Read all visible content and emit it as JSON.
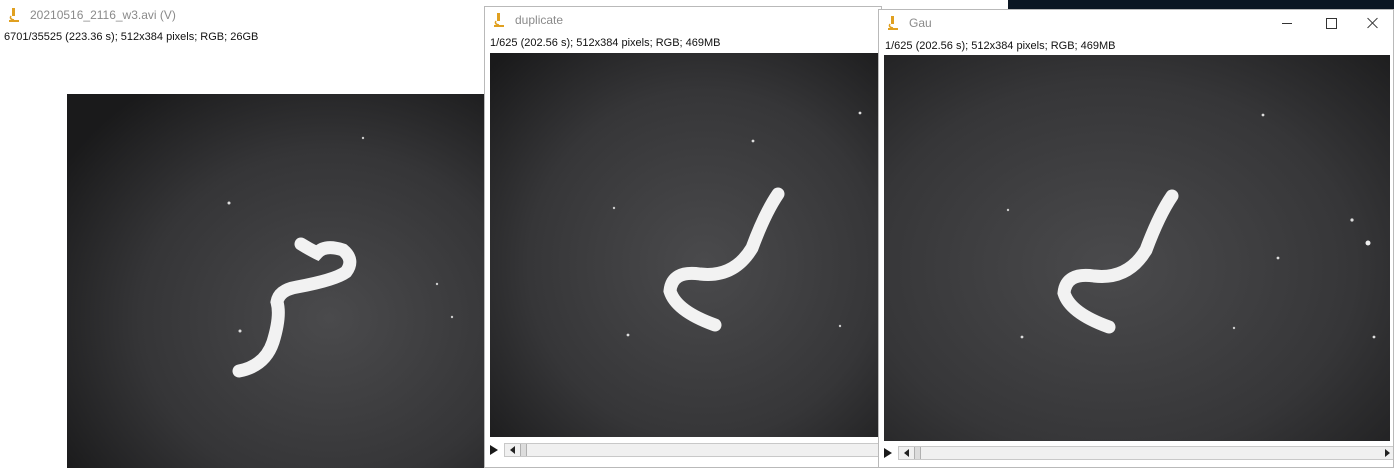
{
  "windows": [
    {
      "title": "20210516_2116_w3.avi (V)",
      "info": "6701/35525 (223.36 s); 512x384 pixels; RGB; 26GB",
      "icon": "microscope-icon",
      "image": "worm video frame"
    },
    {
      "title": "duplicate",
      "info": "1/625 (202.56 s); 512x384 pixels; RGB; 469MB",
      "icon": "microscope-icon",
      "image": "worm duplicate frame"
    },
    {
      "title": "Gau",
      "info": "1/625 (202.56 s); 512x384 pixels; RGB; 469MB",
      "icon": "microscope-icon",
      "image": "worm gaussian frame"
    }
  ],
  "window_controls": [
    "minimize-icon",
    "maximize-icon",
    "close-icon"
  ],
  "colors": {
    "title_text": "#8a8a8a",
    "icon": "#e0a020",
    "canvas": "#000000"
  }
}
